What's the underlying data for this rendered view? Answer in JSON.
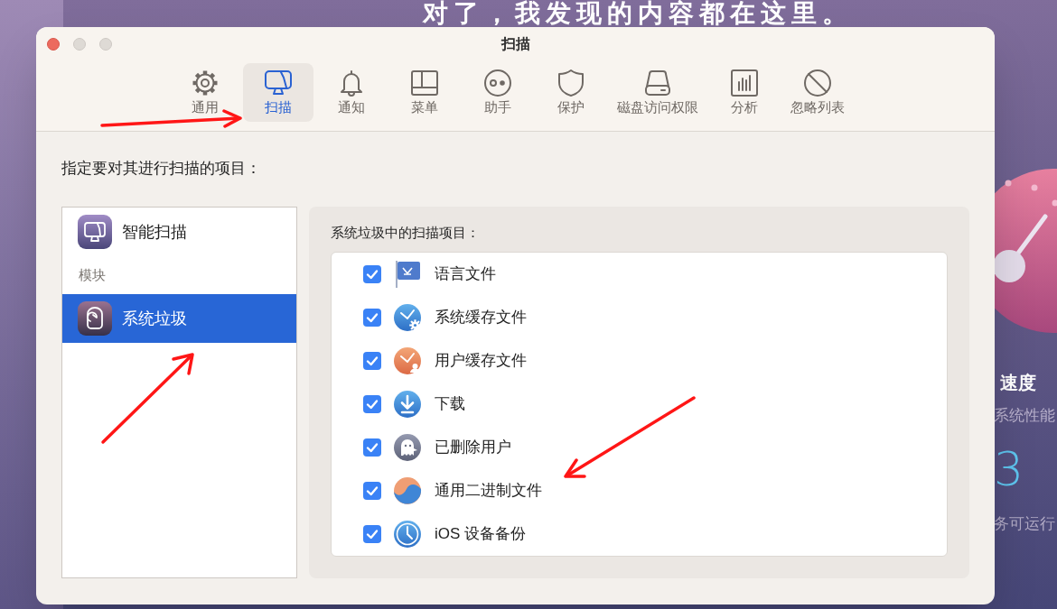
{
  "background": {
    "headline": "对了，我发现的内容都在这里。",
    "speed_card": {
      "title": "速度",
      "subtitle": "系统性能",
      "value": "3",
      "caption": "务可运行"
    }
  },
  "window": {
    "title": "扫描"
  },
  "toolbar": [
    {
      "label": "通用",
      "selected": false
    },
    {
      "label": "扫描",
      "selected": true
    },
    {
      "label": "通知",
      "selected": false
    },
    {
      "label": "菜单",
      "selected": false
    },
    {
      "label": "助手",
      "selected": false
    },
    {
      "label": "保护",
      "selected": false
    },
    {
      "label": "磁盘访问权限",
      "selected": false
    },
    {
      "label": "分析",
      "selected": false
    },
    {
      "label": "忽略列表",
      "selected": false
    }
  ],
  "prompt": "指定要对其进行扫描的项目：",
  "module_list": [
    {
      "kind": "item",
      "label": "智能扫描",
      "selected": false
    },
    {
      "kind": "header",
      "label": "模块"
    },
    {
      "kind": "item",
      "label": "系统垃圾",
      "selected": true
    }
  ],
  "scan_items": {
    "title": "系统垃圾中的扫描项目：",
    "items": [
      {
        "label": "语言文件",
        "checked": true
      },
      {
        "label": "系统缓存文件",
        "checked": true
      },
      {
        "label": "用户缓存文件",
        "checked": true
      },
      {
        "label": "下载",
        "checked": true
      },
      {
        "label": "已删除用户",
        "checked": true
      },
      {
        "label": "通用二进制文件",
        "checked": true
      },
      {
        "label": "iOS 设备备份",
        "checked": true
      }
    ]
  }
}
